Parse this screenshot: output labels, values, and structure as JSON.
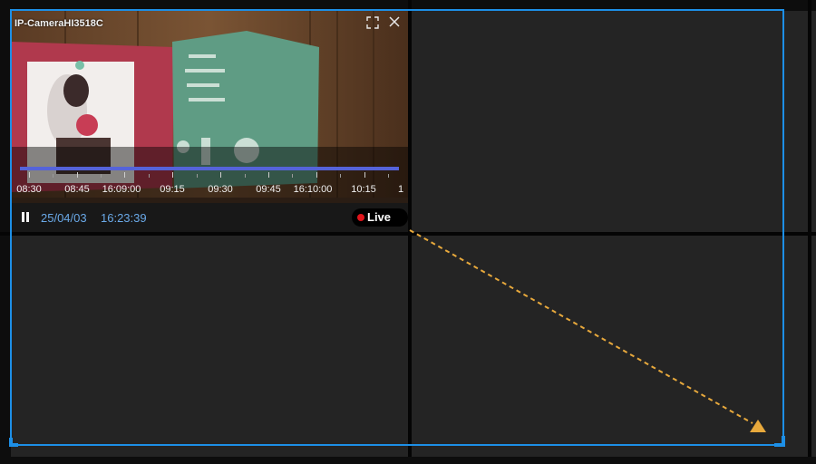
{
  "camera": {
    "title": "IP-CameraHI3518C",
    "date": "25/04/03",
    "time": "16:23:39",
    "live_label": "Live",
    "live_dot_color": "#e0141b",
    "timestamp_color": "#6aa9e8",
    "timeline_color": "#5563d9",
    "icons": {
      "fullscreen": "fullscreen-icon",
      "close": "close-icon",
      "pause": "pause-icon"
    }
  },
  "timeline": {
    "labels": [
      "08:30",
      "08:45",
      "16:09:00",
      "09:15",
      "09:30",
      "09:45",
      "16:10:00",
      "10:15",
      "1"
    ]
  },
  "grid": {
    "background": "#242424",
    "divider": "#050505"
  },
  "selection": {
    "color": "#1d8fe6"
  },
  "drag_arrow": {
    "color": "#e8a93c"
  }
}
